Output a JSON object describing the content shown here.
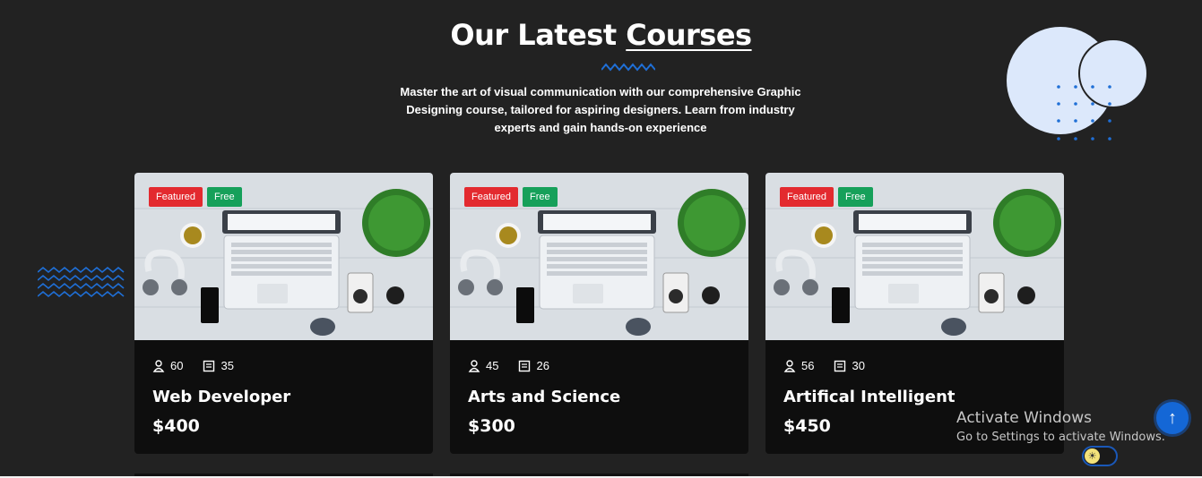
{
  "section": {
    "title_main": "Our Latest ",
    "title_accent": "Courses",
    "subtitle": "Master the art of visual communication with our comprehensive Graphic Designing course, tailored for aspiring designers. Learn from industry experts and gain hands-on experience"
  },
  "courses": [
    {
      "badge_featured": "Featured",
      "badge_free": "Free",
      "students": "60",
      "lessons": "35",
      "title": "Web Developer",
      "price": "$400"
    },
    {
      "badge_featured": "Featured",
      "badge_free": "Free",
      "students": "45",
      "lessons": "26",
      "title": "Arts and Science",
      "price": "$300"
    },
    {
      "badge_featured": "Featured",
      "badge_free": "Free",
      "students": "56",
      "lessons": "30",
      "title": "Artifical Intelligent",
      "price": "$450"
    }
  ],
  "overlay": {
    "activate_title": "Activate Windows",
    "activate_sub": "Go to Settings to activate Windows."
  },
  "icons": {
    "students": "user-icon",
    "lessons": "book-icon",
    "scroll_top": "arrow-up-icon",
    "theme": "sun-icon"
  },
  "colors": {
    "background": "#222222",
    "card": "#0e0e0e",
    "featured": "#e32a2f",
    "free": "#16a05a",
    "accent_blue": "#1467d6"
  }
}
